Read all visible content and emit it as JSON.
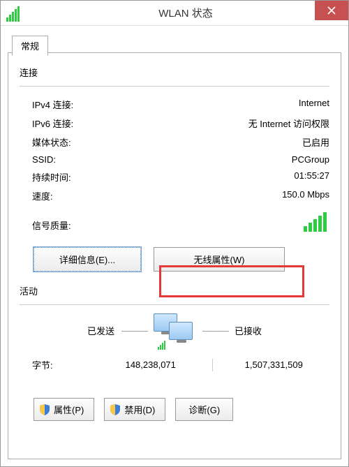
{
  "window": {
    "title": "WLAN 状态"
  },
  "tab": {
    "label": "常规"
  },
  "connection": {
    "section_title": "连接",
    "ipv4_label": "IPv4 连接:",
    "ipv4_value": "Internet",
    "ipv6_label": "IPv6 连接:",
    "ipv6_value": "无 Internet 访问权限",
    "media_label": "媒体状态:",
    "media_value": "已启用",
    "ssid_label": "SSID:",
    "ssid_value": "PCGroup",
    "duration_label": "持续时间:",
    "duration_value": "01:55:27",
    "speed_label": "速度:",
    "speed_value": "150.0 Mbps",
    "signal_label": "信号质量:"
  },
  "buttons": {
    "details": "详细信息(E)...",
    "wireless": "无线属性(W)",
    "properties": "属性(P)",
    "disable": "禁用(D)",
    "diagnose": "诊断(G)"
  },
  "activity": {
    "section_title": "活动",
    "sent_label": "已发送",
    "received_label": "已接收",
    "bytes_label": "字节:",
    "bytes_sent": "148,238,071",
    "bytes_received": "1,507,331,509"
  }
}
